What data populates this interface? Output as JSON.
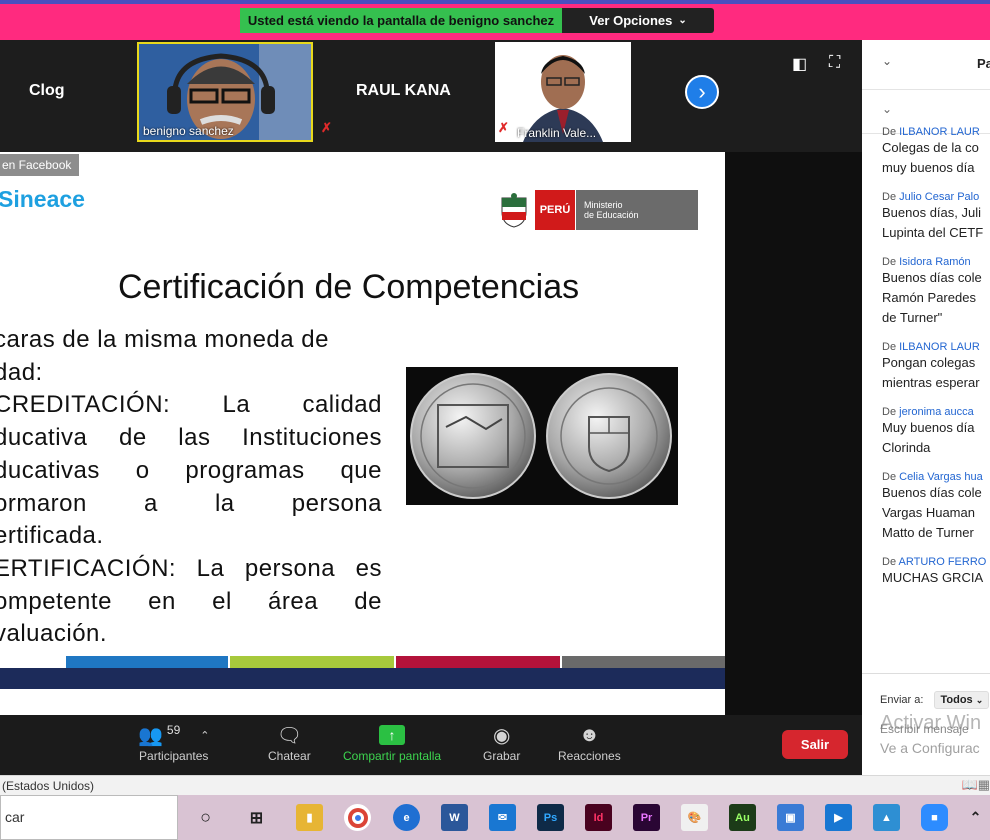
{
  "banner": {
    "sharing_text": "Usted está viendo la pantalla de benigno sanchez",
    "options_label": "Ver Opciones"
  },
  "strip": {
    "tile_clog": "Clog",
    "tile_raul": "RAUL KANA",
    "cam1_label": "benigno sanchez",
    "cam2_label": "Franklin Vale..."
  },
  "slide": {
    "fb_tag": "en Facebook",
    "brand": "Sineace",
    "peru": "PERÚ",
    "ministerio_line1": "Ministerio",
    "ministerio_line2": "de Educación",
    "title": "Certificación de Competencias",
    "lines": [
      "caras de la misma moneda de",
      "dad:",
      "CREDITACIÓN: La calidad",
      "ducativa de las Instituciones",
      "ducativas o programas que",
      "ormaron a la persona",
      "ertificada.",
      "ERTIFICACIÓN: La persona es",
      "ompetente en el área de",
      "valuación."
    ],
    "bar_colors": [
      "#ffffff",
      "#1f77c3",
      "#a7c93c",
      "#b3123a",
      "#6a6a6a"
    ]
  },
  "toolbar": {
    "participants_count": "59",
    "participants": "Participantes",
    "chat": "Chatear",
    "share": "Compartir pantalla",
    "record": "Grabar",
    "reactions": "Reacciones",
    "leave": "Salir"
  },
  "chat": {
    "header_partial": "Pa",
    "messages": [
      {
        "from_prefix": "De",
        "from": "ILBANOR LAUR",
        "lines": [
          "Colegas de la co",
          "muy buenos día"
        ]
      },
      {
        "from_prefix": "De",
        "from": "Julio Cesar Palo",
        "lines": [
          "Buenos días, Juli",
          "Lupinta del CETF"
        ]
      },
      {
        "from_prefix": "De",
        "from": "Isidora Ramón",
        "lines": [
          "Buenos días cole",
          "Ramón Paredes",
          "de Turner\""
        ]
      },
      {
        "from_prefix": "De",
        "from": "ILBANOR LAUR",
        "lines": [
          "Pongan colegas",
          "mientras esperar"
        ]
      },
      {
        "from_prefix": "De",
        "from": "jeronima aucca",
        "lines": [
          "Muy buenos día",
          "Clorinda"
        ]
      },
      {
        "from_prefix": "De",
        "from": "Celia Vargas hua",
        "lines": [
          "Buenos días cole",
          "Vargas Huaman",
          "Matto de Turner"
        ]
      },
      {
        "from_prefix": "De",
        "from": "ARTURO FERRO",
        "lines": [
          "MUCHAS GRCIA"
        ]
      }
    ],
    "send_to": "Enviar a:",
    "send_target": "Todos",
    "write_placeholder": "Escribir mensaje",
    "watermark1": "Activar Win",
    "watermark2": "Ve a Configurac"
  },
  "status": {
    "language": "(Estados Unidos)"
  },
  "taskbar": {
    "search_text": "car"
  }
}
